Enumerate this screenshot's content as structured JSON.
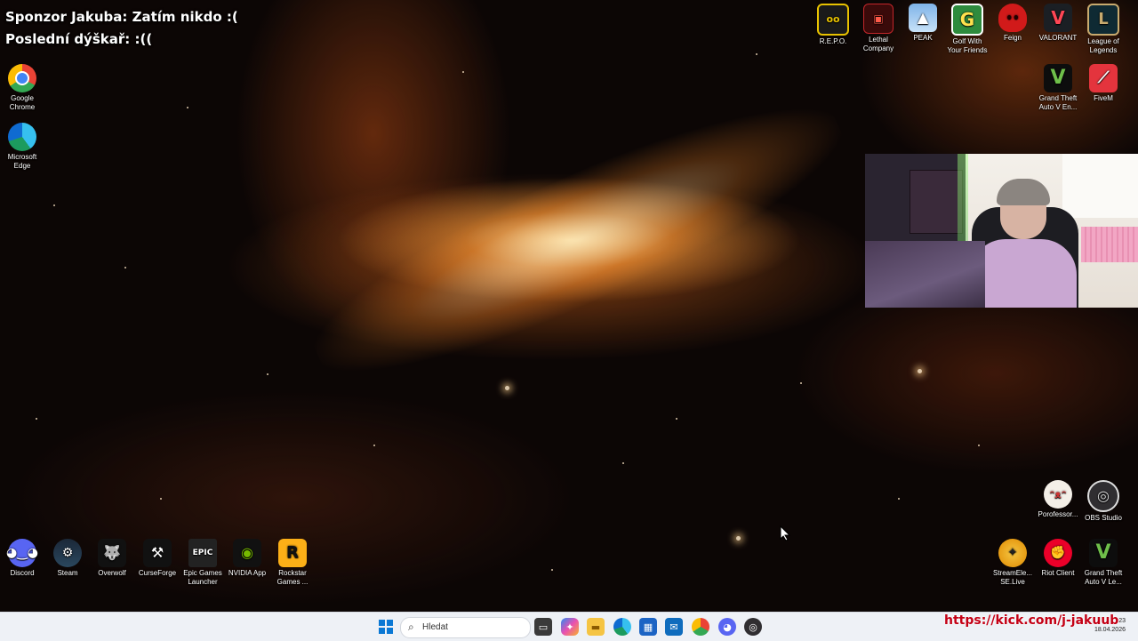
{
  "overlay": {
    "sponsor_text": "Sponzor Jakuba: Zatím nikdo :(",
    "last_donor_text": "Poslední dýškař: :(("
  },
  "desktop_icons_left": [
    {
      "label": "Google Chrome",
      "icon": "chrome-icon"
    },
    {
      "label": "Microsoft Edge",
      "icon": "edge-icon"
    }
  ],
  "desktop_icons_top_right": [
    {
      "label": "R.E.P.O.",
      "icon": "repo-icon"
    },
    {
      "label": "Lethal Company",
      "icon": "lethal-company-icon"
    },
    {
      "label": "PEAK",
      "icon": "peak-icon"
    },
    {
      "label": "Golf With Your Friends",
      "icon": "golf-icon"
    },
    {
      "label": "Feign",
      "icon": "feign-icon"
    },
    {
      "label": "VALORANT",
      "icon": "valorant-icon"
    },
    {
      "label": "League of Legends",
      "icon": "league-icon"
    }
  ],
  "desktop_icons_second_row_right": [
    {
      "label": "Grand Theft Auto V En...",
      "icon": "gta-icon"
    },
    {
      "label": "FiveM",
      "icon": "fivem-icon"
    }
  ],
  "desktop_icons_mid_right": [
    {
      "label": "Porofessor...",
      "icon": "porofessor-icon"
    },
    {
      "label": "OBS Studio",
      "icon": "obs-icon"
    }
  ],
  "desktop_icons_bottom_right": [
    {
      "label": "StreamEle... SE.Live",
      "icon": "streamelements-icon"
    },
    {
      "label": "Riot Client",
      "icon": "riot-icon"
    },
    {
      "label": "Grand Theft Auto V Le...",
      "icon": "gta-legacy-icon"
    }
  ],
  "desktop_icons_bottom_left": [
    {
      "label": "Discord",
      "icon": "discord-icon"
    },
    {
      "label": "Steam",
      "icon": "steam-icon"
    },
    {
      "label": "Overwolf",
      "icon": "overwolf-icon"
    },
    {
      "label": "CurseForge",
      "icon": "curseforge-icon"
    },
    {
      "label": "Epic Games Launcher",
      "icon": "epic-icon"
    },
    {
      "label": "NVIDIA App",
      "icon": "nvidia-icon"
    },
    {
      "label": "Rockstar Games ...",
      "icon": "rockstar-icon"
    }
  ],
  "taskbar": {
    "search_placeholder": "Hledat",
    "time": "23",
    "date": "18.04.2026"
  },
  "stream": {
    "url": "https://kick.com/j-jakuub"
  },
  "colors": {
    "kick_url": "#c40015",
    "taskbar_bg": "#eef1f6"
  }
}
